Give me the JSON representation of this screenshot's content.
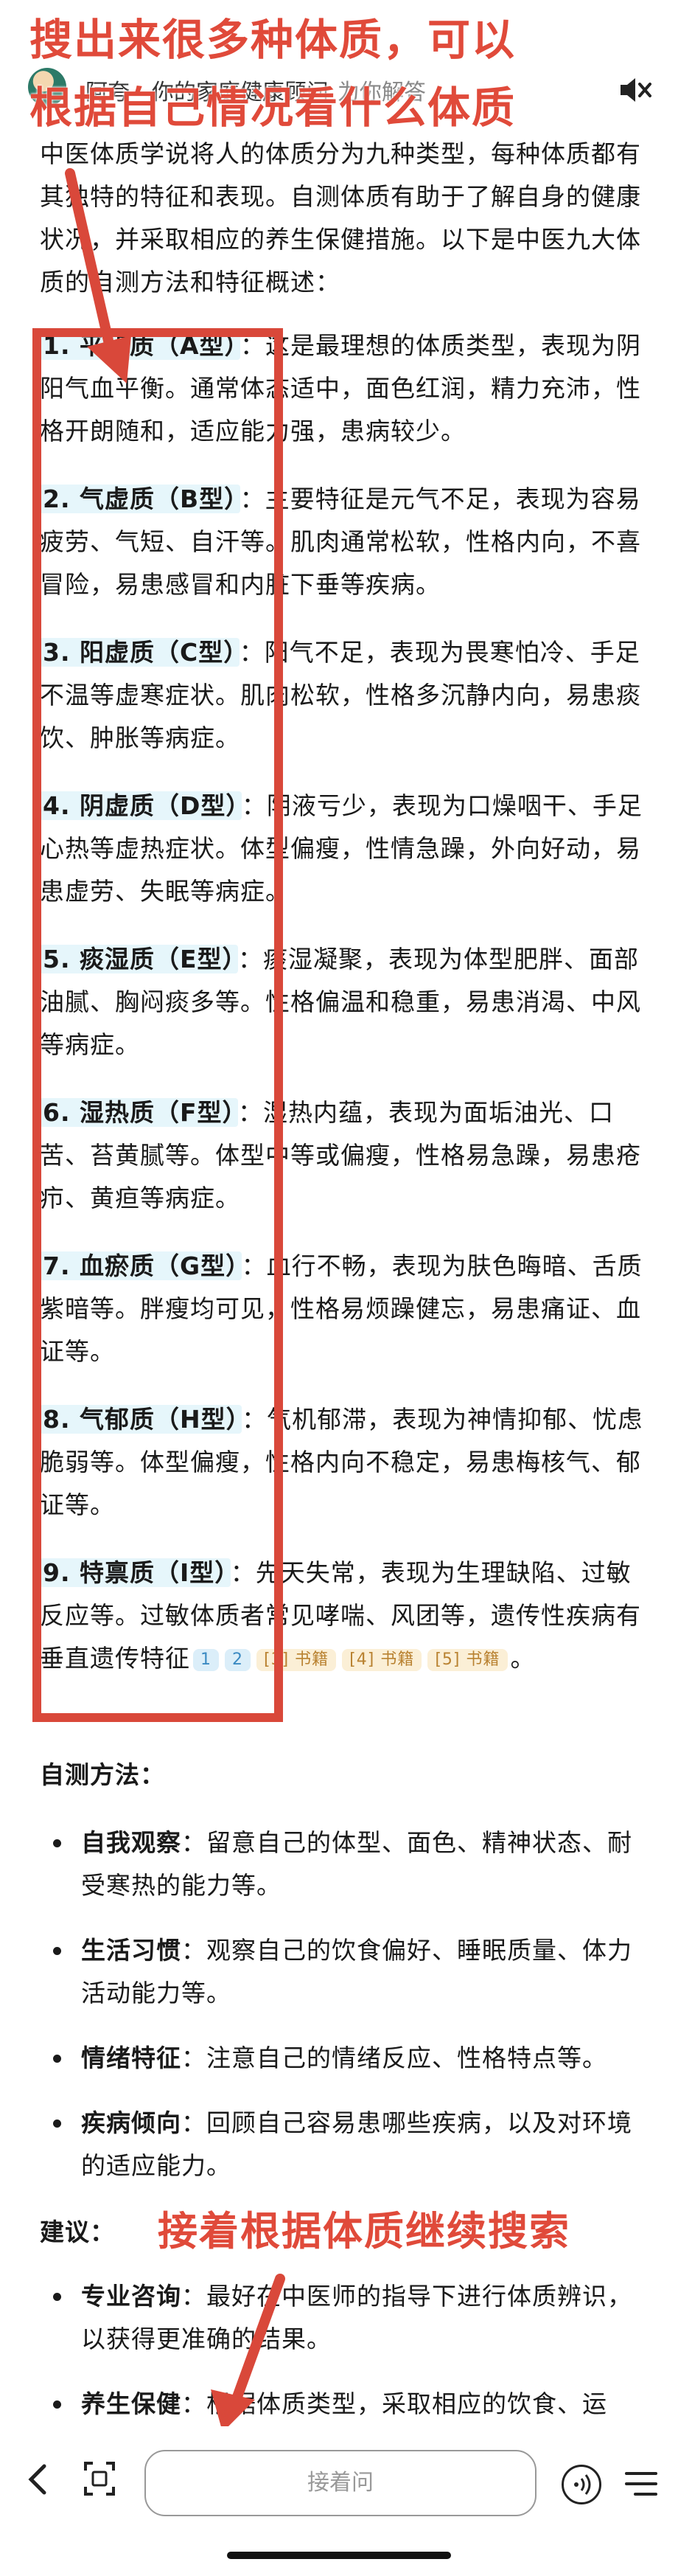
{
  "header": {
    "bot_name": "阿夸 - 你的家庭健康顾问",
    "bot_subtitle": "为你解答"
  },
  "annotations": {
    "top_line1": "搜出来很多种体质，可以",
    "top_line2": "根据自己情况看什么体质",
    "bottom": "接着根据体质继续搜索",
    "accent_color": "#d9483a"
  },
  "intro": "中医体质学说将人的体质分为九种类型，每种体质都有其独特的特征和表现。自测体质有助于了解自身的健康状况，并采取相应的养生保健措施。以下是中医九大体质的自测方法和特征概述：",
  "types": [
    {
      "name": "1. 平和质（A型）",
      "desc": "：这是最理想的体质类型，表现为阴阳气血平衡。通常体态适中，面色红润，精力充沛，性格开朗随和，适应能力强，患病较少。"
    },
    {
      "name": "2. 气虚质（B型）",
      "desc": "：主要特征是元气不足，表现为容易疲劳、气短、自汗等。肌肉通常松软，性格内向，不喜冒险，易患感冒和内脏下垂等疾病。"
    },
    {
      "name": "3. 阳虚质（C型）",
      "desc": "：阳气不足，表现为畏寒怕冷、手足不温等虚寒症状。肌肉松软，性格多沉静内向，易患痰饮、肿胀等病症。"
    },
    {
      "name": "4. 阴虚质（D型）",
      "desc": "：阴液亏少，表现为口燥咽干、手足心热等虚热症状。体型偏瘦，性情急躁，外向好动，易患虚劳、失眠等病症。"
    },
    {
      "name": "5. 痰湿质（E型）",
      "desc": "：痰湿凝聚，表现为体型肥胖、面部油腻、胸闷痰多等。性格偏温和稳重，易患消渴、中风等病症。"
    },
    {
      "name": "6. 湿热质（F型）",
      "desc": "：湿热内蕴，表现为面垢油光、口苦、苔黄腻等。体型中等或偏瘦，性格易急躁，易患疮疖、黄疸等病症。"
    },
    {
      "name": "7. 血瘀质（G型）",
      "desc": "：血行不畅，表现为肤色晦暗、舌质紫暗等。胖瘦均可见，性格易烦躁健忘，易患痛证、血证等。"
    },
    {
      "name": "8. 气郁质（H型）",
      "desc": "：气机郁滞，表现为神情抑郁、忧虑脆弱等。体型偏瘦，性格内向不稳定，易患梅核气、郁证等。"
    },
    {
      "name": "9. 特禀质（I型）",
      "desc": "：先天失常，表现为生理缺陷、过敏反应等。过敏体质者常见哮喘、风团等，遗传性疾病有垂直遗传特征"
    }
  ],
  "refs": {
    "r1": "1",
    "r2": "2",
    "r3": "[3] 书籍",
    "r4": "[4] 书籍",
    "r5": "[5] 书籍",
    "tail": "。"
  },
  "self_test": {
    "title": "自测方法：",
    "items": [
      {
        "label": "自我观察",
        "text": "：留意自己的体型、面色、精神状态、耐受寒热的能力等。"
      },
      {
        "label": "生活习惯",
        "text": "：观察自己的饮食偏好、睡眠质量、体力活动能力等。"
      },
      {
        "label": "情绪特征",
        "text": "：注意自己的情绪反应、性格特点等。"
      },
      {
        "label": "疾病倾向",
        "text": "：回顾自己容易患哪些疾病，以及对环境的适应能力。"
      }
    ]
  },
  "advice": {
    "title": "建议：",
    "items": [
      {
        "label": "专业咨询",
        "text": "：最好在中医师的指导下进行体质辨识，以获得更准确的结果。"
      },
      {
        "label": "养生保健",
        "text": "：根据体质类型，采取相应的饮食、运"
      }
    ]
  },
  "bottom_bar": {
    "input_placeholder": "接着问"
  }
}
